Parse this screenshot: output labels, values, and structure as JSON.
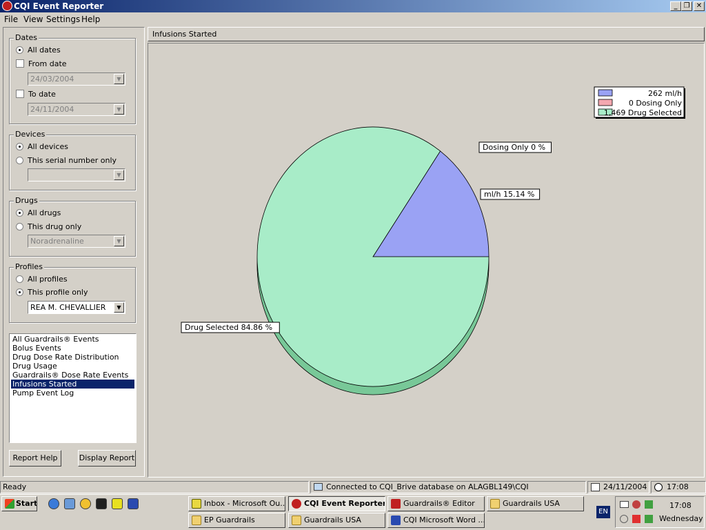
{
  "window": {
    "title": "CQI Event Reporter",
    "min": "_",
    "restore": "❐",
    "close": "✕"
  },
  "menu": [
    "File",
    "View",
    "Settings",
    "Help"
  ],
  "dates": {
    "title": "Dates",
    "all_label": "All dates",
    "from_label": "From date",
    "from_value": "24/03/2004",
    "to_label": "To date",
    "to_value": "24/11/2004"
  },
  "devices": {
    "title": "Devices",
    "all_label": "All devices",
    "serial_label": "This serial number only",
    "serial_value": ""
  },
  "drugs": {
    "title": "Drugs",
    "all_label": "All drugs",
    "this_label": "This drug only",
    "drug_value": "Noradrenaline"
  },
  "profiles": {
    "title": "Profiles",
    "all_label": "All profiles",
    "this_label": "This profile only",
    "profile_value": "REA M. CHEVALLIER"
  },
  "reports": [
    "All Guardrails® Events",
    "Bolus Events",
    "Drug Dose Rate Distribution",
    "Drug Usage",
    "Guardrails® Dose Rate Events",
    "Infusions Started",
    "Pump Event Log"
  ],
  "selected_report": "Infusions Started",
  "buttons": {
    "report_help": "Report Help",
    "display_report": "Display Report"
  },
  "report_title": "Infusions Started",
  "colors": {
    "ml_h": "#9aa2f4",
    "dosing_only": "#f4a8b0",
    "drug_selected": "#a8ecc8",
    "drug_selected_shadow": "#78c898"
  },
  "chart_data": {
    "type": "pie",
    "slices": [
      {
        "label": "ml/h",
        "value": 262,
        "percent": "15.14 %",
        "legend": "262 ml/h"
      },
      {
        "label": "Dosing Only",
        "value": 0,
        "percent": "0 %",
        "legend": "0 Dosing Only"
      },
      {
        "label": "Drug Selected",
        "value": 1469,
        "percent": "84.86 %",
        "legend": "1,469 Drug Selected"
      }
    ],
    "data_labels": [
      "Dosing Only 0 %",
      "ml/h 15.14 %",
      "Drug Selected 84.86 %"
    ],
    "legend_position": "top-right"
  },
  "status": {
    "ready": "Ready",
    "connection": "Connected to CQI_Brive database on ALAGBL149\\CQI",
    "date": "24/11/2004",
    "time": "17:08"
  },
  "taskbar": {
    "start": "Start",
    "tasks": [
      "Inbox - Microsoft Ou...",
      "CQI Event Reporter",
      "Guardrails® Editor",
      "Guardrails USA",
      "EP Guardrails",
      "Guardrails USA",
      "CQI Microsoft Word ..."
    ],
    "lang": "EN",
    "clock_time": "17:08",
    "clock_day": "Wednesday"
  }
}
